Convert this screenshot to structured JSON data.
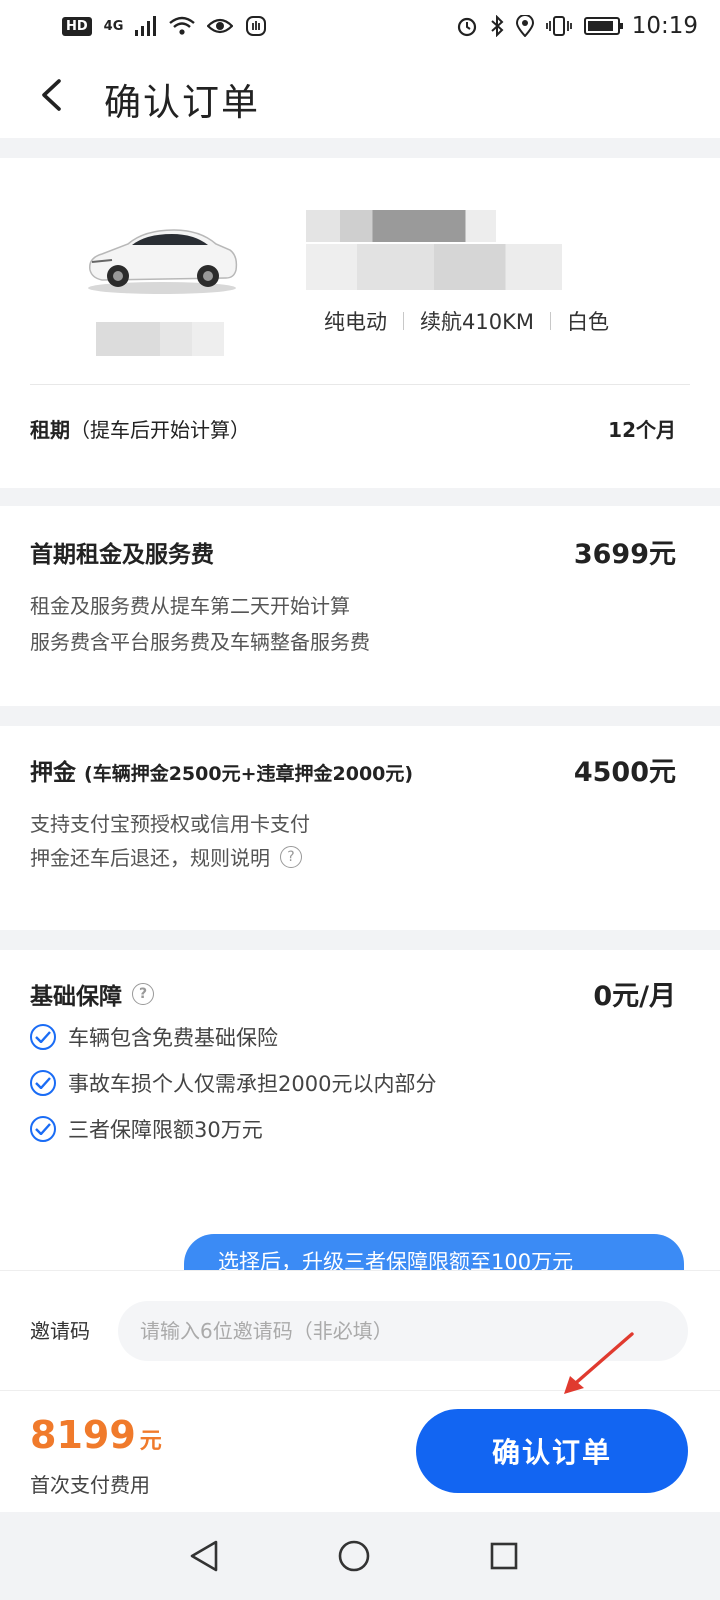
{
  "status_bar": {
    "hd": "HD",
    "network": "4G",
    "time": "10:19",
    "battery_level": 0.9
  },
  "header": {
    "title": "确认订单"
  },
  "car": {
    "specs": [
      "纯电动",
      "续航410KM",
      "白色"
    ],
    "lease_label": "租期",
    "lease_note": "（提车后开始计算）",
    "lease_value": "12个月"
  },
  "fee": {
    "title": "首期租金及服务费",
    "amount": "3699元",
    "lines": [
      "租金及服务费从提车第二天开始计算",
      "服务费含平台服务费及车辆整备服务费"
    ]
  },
  "deposit": {
    "title": "押金",
    "subtitle": "(车辆押金2500元+违章押金2000元)",
    "amount": "4500元",
    "lines": [
      "支持支付宝预授权或信用卡支付",
      "押金还车后退还，规则说明"
    ]
  },
  "insurance": {
    "title": "基础保障",
    "amount": "0元/月",
    "items": [
      "车辆包含免费基础保险",
      "事故车损个人仅需承担2000元以内部分",
      "三者保障限额30万元"
    ],
    "upgrade_banner": "选择后，升级三者保障限额至100万元"
  },
  "invite": {
    "label": "邀请码",
    "placeholder": "请输入6位邀请码（非必填）",
    "value": ""
  },
  "footer": {
    "total_amount": "8199",
    "total_unit": "元",
    "total_label": "首次支付费用",
    "confirm_label": "确认订单"
  },
  "colors": {
    "accent": "#1265f2",
    "price": "#f07a2b",
    "check": "#1a6cf5",
    "annotation_arrow": "#e03a2f"
  }
}
